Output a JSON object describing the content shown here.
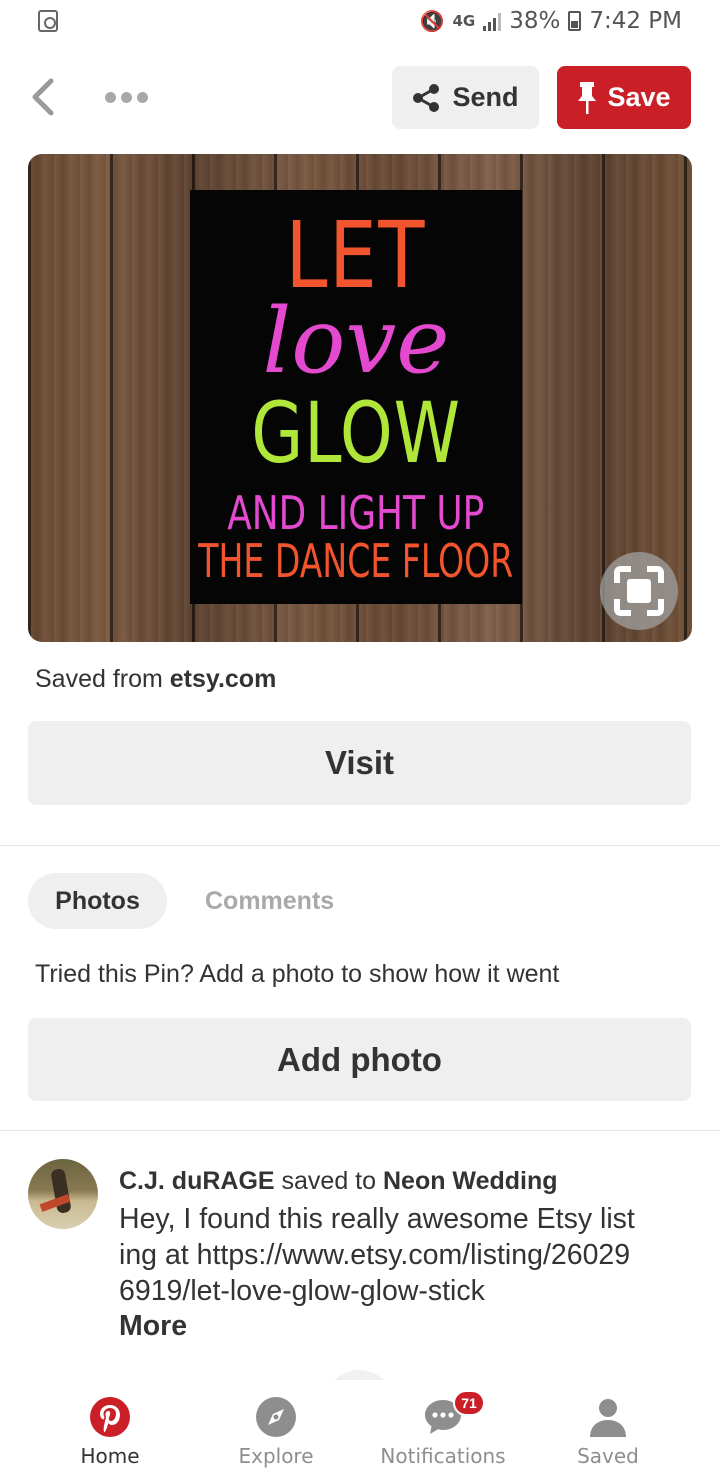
{
  "status_bar": {
    "network": "4G",
    "battery": "38%",
    "time": "7:42 PM"
  },
  "toolbar": {
    "send_label": "Send",
    "save_label": "Save"
  },
  "pin_image": {
    "line1": "LET",
    "line2": "love",
    "line3": "GLOW",
    "line4": "AND LIGHT UP",
    "line5": "THE DANCE FLOOR"
  },
  "source": {
    "prefix": "Saved from ",
    "domain": "etsy.com"
  },
  "visit_label": "Visit",
  "tabs": [
    {
      "label": "Photos",
      "active": true
    },
    {
      "label": "Comments",
      "active": false
    }
  ],
  "tried_prompt": "Tried this Pin? Add a photo to show how it went",
  "add_photo_label": "Add photo",
  "activity": {
    "user": "C.J. duRAGE",
    "action": " saved to ",
    "board": "Neon Wedding",
    "description": "Hey, I found this really awesome Etsy listing at https://www.etsy.com/listing/260296919/let-love-glow-glow-stick",
    "more_label": "More"
  },
  "bottom_nav": [
    {
      "label": "Home",
      "icon": "pinterest-logo-icon",
      "active": true
    },
    {
      "label": "Explore",
      "icon": "compass-icon",
      "active": false
    },
    {
      "label": "Notifications",
      "icon": "speech-bubble-icon",
      "active": false,
      "badge": "71"
    },
    {
      "label": "Saved",
      "icon": "person-icon",
      "active": false
    }
  ],
  "colors": {
    "brand_red": "#cb1f27",
    "button_gray": "#efefef",
    "text_dark": "#333333",
    "text_muted": "#a9a9a9"
  }
}
